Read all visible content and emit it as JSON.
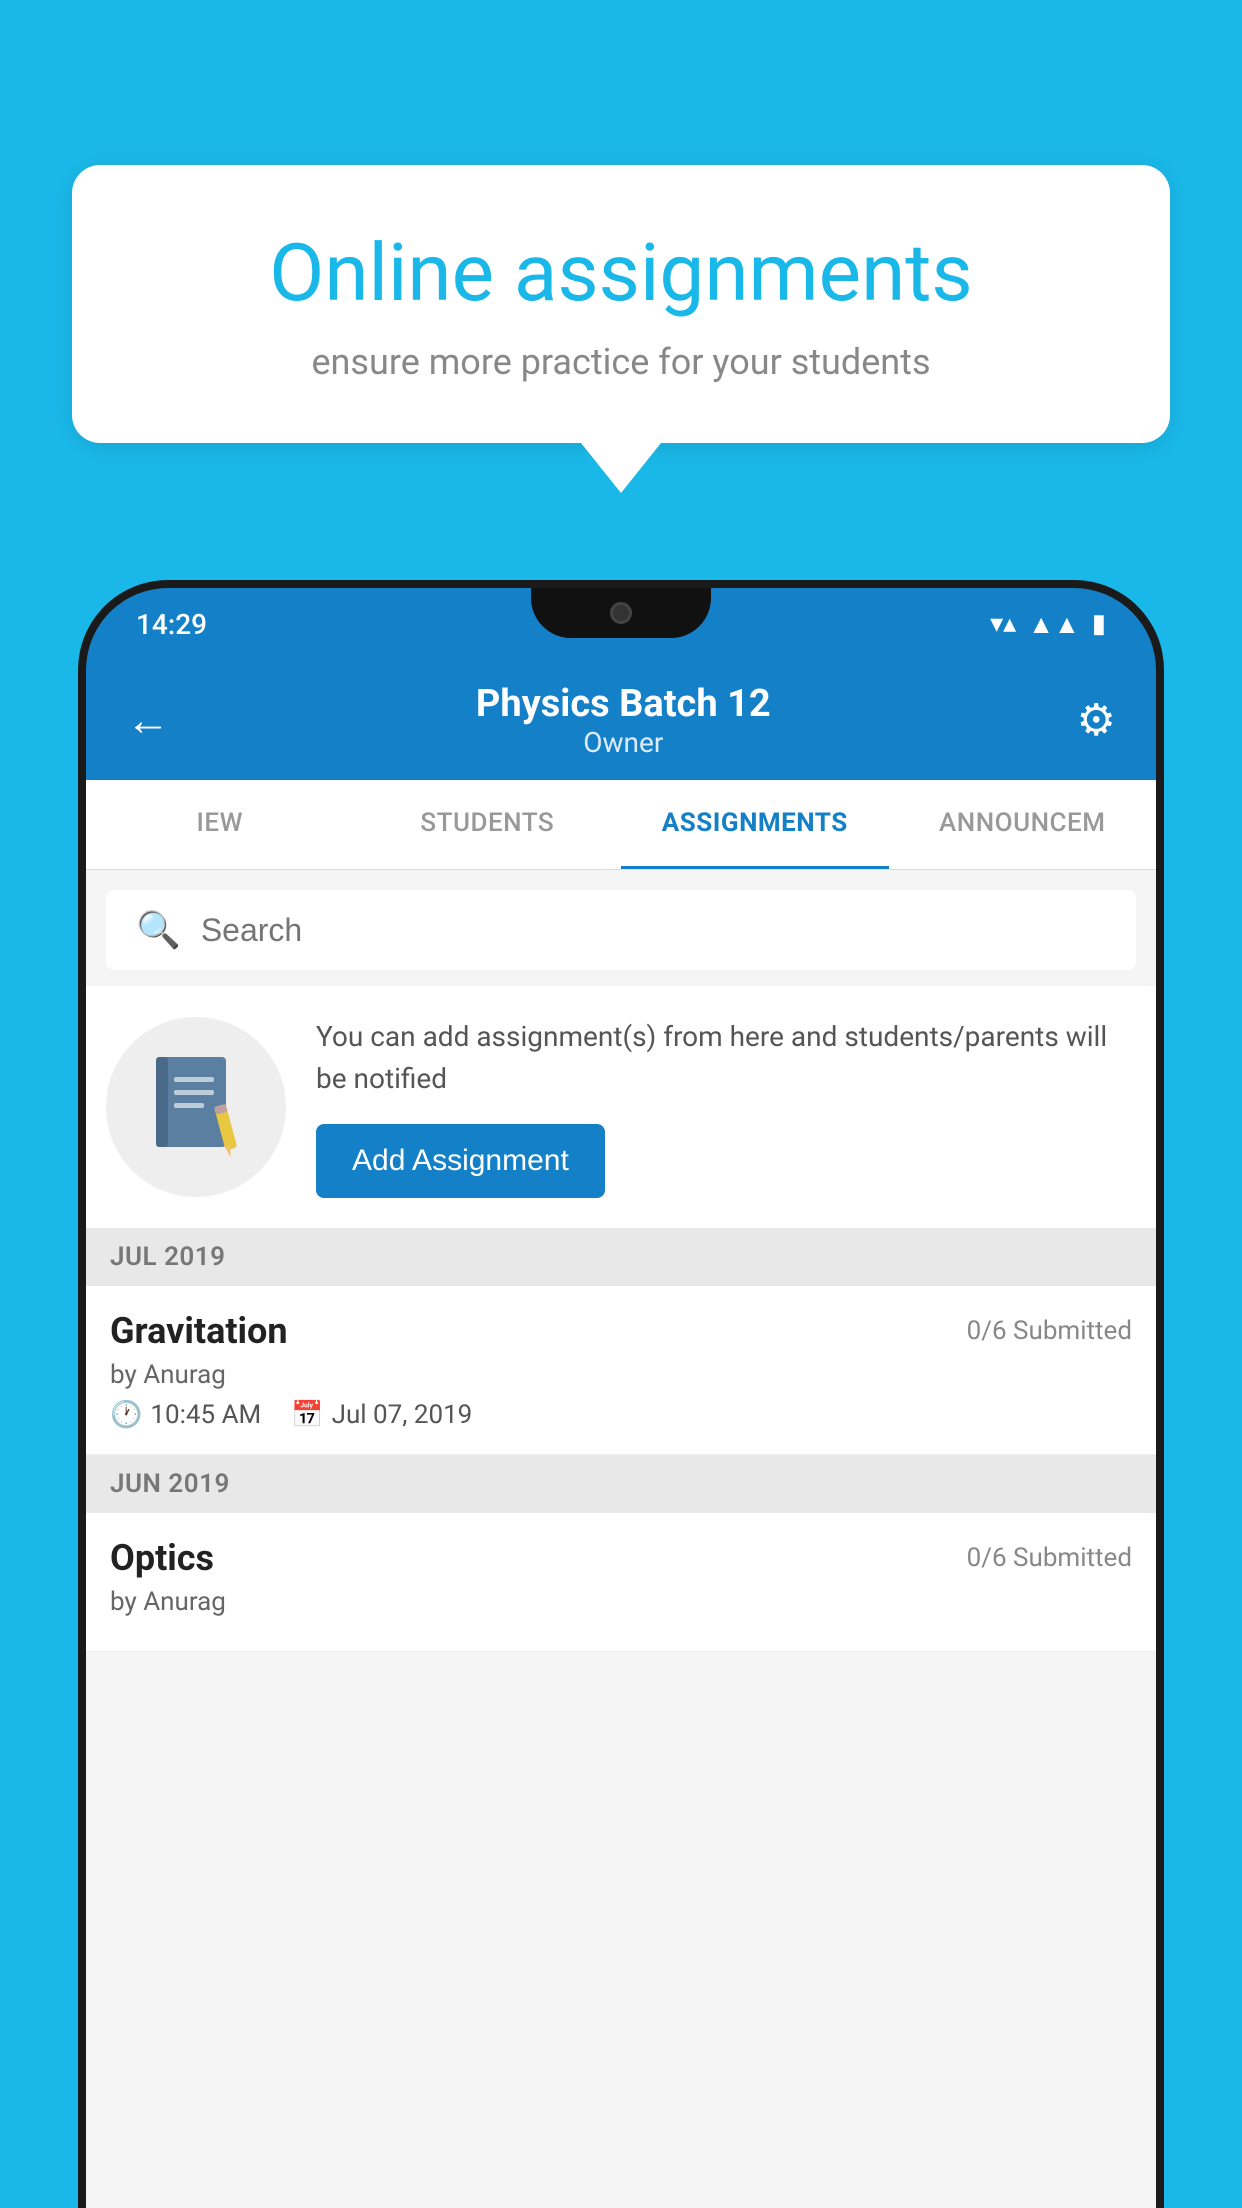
{
  "background_color": "#1ab8e8",
  "speech_bubble": {
    "title": "Online assignments",
    "subtitle": "ensure more practice for your students"
  },
  "status_bar": {
    "time": "14:29",
    "icons": [
      "wifi",
      "signal",
      "battery"
    ]
  },
  "header": {
    "back_label": "←",
    "title": "Physics Batch 12",
    "subtitle": "Owner",
    "settings_icon": "⚙"
  },
  "tabs": [
    {
      "label": "IEW",
      "active": false
    },
    {
      "label": "STUDENTS",
      "active": false
    },
    {
      "label": "ASSIGNMENTS",
      "active": true
    },
    {
      "label": "ANNOUNCEM",
      "active": false
    }
  ],
  "search": {
    "placeholder": "Search"
  },
  "info_card": {
    "text": "You can add assignment(s) from here and students/parents will be notified",
    "button_label": "Add Assignment"
  },
  "sections": [
    {
      "label": "JUL 2019",
      "assignments": [
        {
          "name": "Gravitation",
          "submitted": "0/6 Submitted",
          "by": "by Anurag",
          "time": "10:45 AM",
          "date": "Jul 07, 2019"
        }
      ]
    },
    {
      "label": "JUN 2019",
      "assignments": [
        {
          "name": "Optics",
          "submitted": "0/6 Submitted",
          "by": "by Anurag",
          "time": "",
          "date": ""
        }
      ]
    }
  ]
}
